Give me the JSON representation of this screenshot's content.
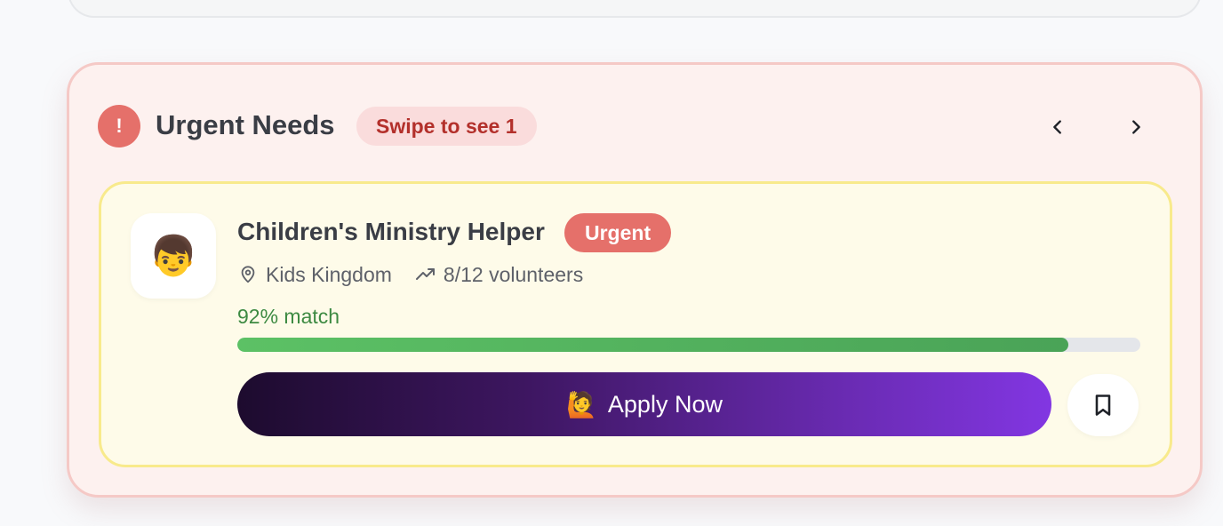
{
  "urgent": {
    "title": "Urgent Needs",
    "alert_symbol": "!",
    "swipe_label": "Swipe to see 1",
    "colors": {
      "panel_bg": "#fdf1ef",
      "alert": "#e5706a",
      "badge_text": "#b3302b"
    }
  },
  "need": {
    "avatar_emoji": "👦",
    "title": "Children's Ministry Helper",
    "badge": "Urgent",
    "location": "Kids Kingdom",
    "volunteers": "8/12 volunteers",
    "match_label": "92% match",
    "match_percent": 92,
    "apply_emoji": "🙋",
    "apply_label": "Apply Now",
    "icons": [
      "map-pin-icon",
      "trending-up-icon",
      "bookmark-icon",
      "chevron-left-icon",
      "chevron-right-icon"
    ],
    "colors": {
      "card_bg": "#fefbe9",
      "match": "#3d8a42",
      "button_start": "#1d0b2e",
      "button_end": "#8236e2"
    }
  }
}
